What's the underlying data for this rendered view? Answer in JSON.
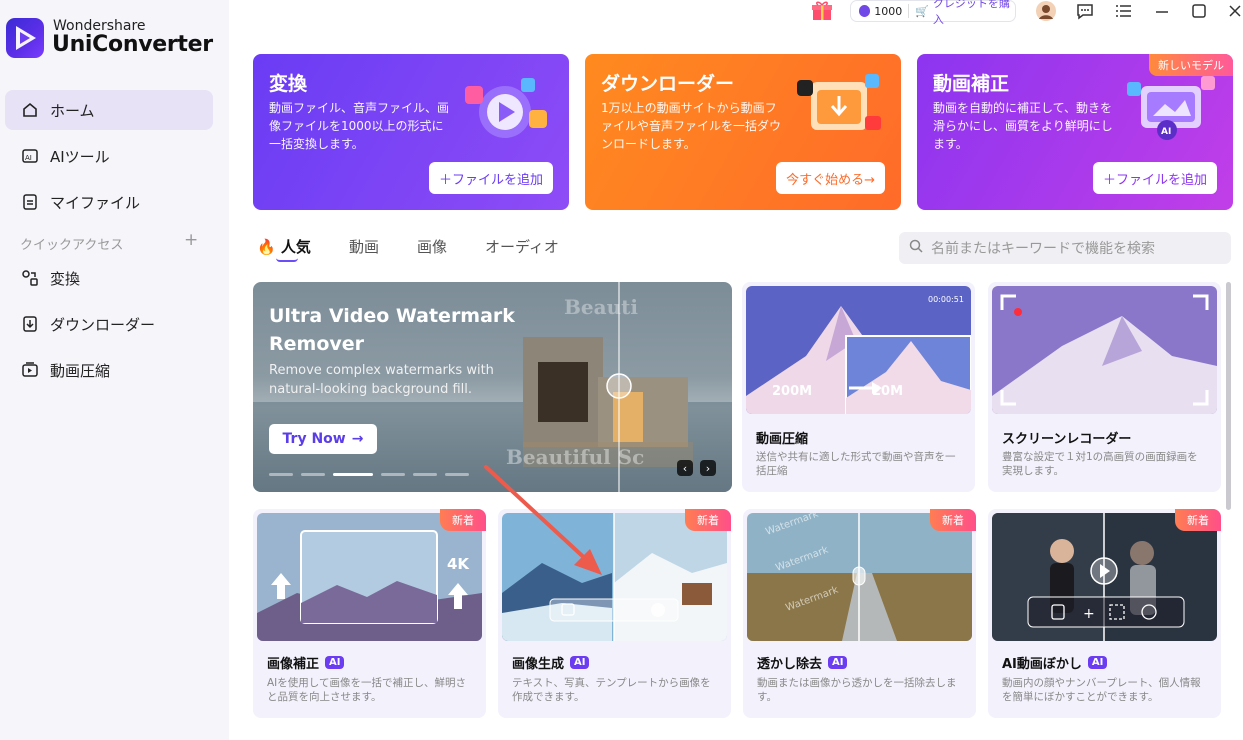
{
  "app": {
    "brand_line1": "Wondershare",
    "brand_line2": "UniConverter"
  },
  "sidebar": {
    "items": [
      {
        "label": "ホーム",
        "icon": "home-icon"
      },
      {
        "label": "AIツール",
        "icon": "ai-icon"
      },
      {
        "label": "マイファイル",
        "icon": "file-icon"
      }
    ],
    "quick_access_label": "クイックアクセス",
    "quick_items": [
      {
        "label": "変換",
        "icon": "convert-icon"
      },
      {
        "label": "ダウンローダー",
        "icon": "download-icon"
      },
      {
        "label": "動画圧縮",
        "icon": "compress-icon"
      }
    ]
  },
  "titlebar": {
    "credits": "1000",
    "buy_label": "クレジットを購入"
  },
  "cards": [
    {
      "title": "変換",
      "desc": "動画ファイル、音声ファイル、画像ファイルを1000以上の形式に一括変換します。",
      "button": "＋ファイルを追加",
      "color1": "#6a3cf4",
      "color2": "#8e4cf6"
    },
    {
      "title": "ダウンローダー",
      "desc": "1万以上の動画サイトから動画ファイルや音声ファイルを一括ダウンロードします。",
      "button": "今すぐ始める→",
      "color1": "#ff8a1f",
      "color2": "#ff6b2a"
    },
    {
      "title": "動画補正",
      "desc": "動画を自動的に補正して、動きを滑らかにし、画質をより鮮明にします。",
      "button": "＋ファイルを追加",
      "badge": "新しいモデル",
      "color1": "#8c35f0",
      "color2": "#c13ee8"
    }
  ],
  "tabs": {
    "popular": "人気",
    "video": "動画",
    "image": "画像",
    "audio": "オーディオ"
  },
  "search": {
    "placeholder": "名前またはキーワードで機能を検索"
  },
  "hero": {
    "title": "Ultra Video Watermark Remover",
    "desc": "Remove complex watermarks with natural-looking background fill.",
    "button": "Try Now",
    "wm1": "Beauti",
    "wm2": "Beautiful Sc"
  },
  "tiles": [
    {
      "title": "動画圧縮",
      "desc": "送信や共有に適した形式で動画や音声を一括圧縮",
      "s1": "200M",
      "s2": "20M",
      "time": "00:00:51"
    },
    {
      "title": "スクリーンレコーダー",
      "desc": "豊富な設定で１対1の高画質の画面録画を実現します。"
    },
    {
      "title": "画像補正",
      "desc": "AIを使用して画像を一括で補正し、鮮明さと品質を向上させます。",
      "badge": "新着",
      "ai": "AI",
      "res": "4K"
    },
    {
      "title": "画像生成",
      "desc": "テキスト、写真、テンプレートから画像を作成できます。",
      "badge": "新着",
      "ai": "AI"
    },
    {
      "title": "透かし除去",
      "desc": "動画または画像から透かしを一括除去します。",
      "badge": "新着",
      "ai": "AI",
      "wm": "Watermark"
    },
    {
      "title": "AI動画ぼかし",
      "desc": "動画内の顔やナンバープレート、個人情報を簡単にぼかすことができます。",
      "badge": "新着",
      "ai": "AI"
    }
  ]
}
